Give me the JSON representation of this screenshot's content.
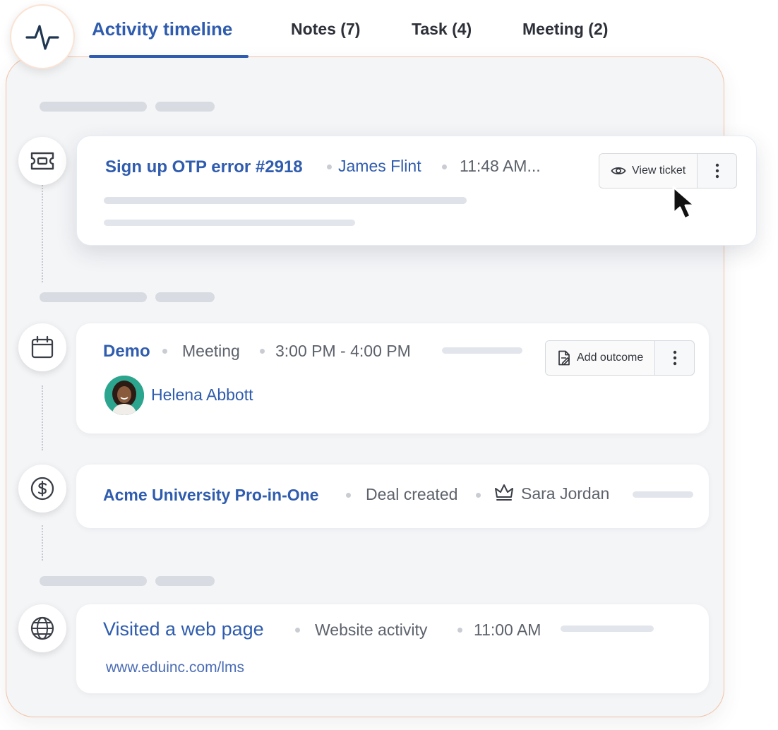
{
  "tabs": [
    {
      "label": "Activity timeline",
      "active": true
    },
    {
      "label": "Notes (7)"
    },
    {
      "label": "Task (4)"
    },
    {
      "label": "Meeting (2)"
    }
  ],
  "colors": {
    "accent": "#2f5cae",
    "panel_border": "#f3c2a4",
    "panel_bg": "#f4f5f7"
  },
  "ticket": {
    "title": "Sign up OTP error #2918",
    "person": "James Flint",
    "time": "11:48 AM...",
    "view_label": "View ticket",
    "icon": "ticket-icon"
  },
  "meeting": {
    "title": "Demo",
    "type": "Meeting",
    "time": "3:00 PM - 4:00 PM",
    "outcome_label": "Add outcome",
    "attendee": "Helena Abbott",
    "icon": "calendar-icon"
  },
  "deal": {
    "title": "Acme University Pro-in-One",
    "status": "Deal created",
    "owner": "Sara Jordan",
    "icon": "dollar-icon"
  },
  "web": {
    "title": "Visited a web page",
    "type": "Website activity",
    "time": "11:00 AM",
    "url": "www.eduinc.com/lms",
    "icon": "globe-icon"
  }
}
